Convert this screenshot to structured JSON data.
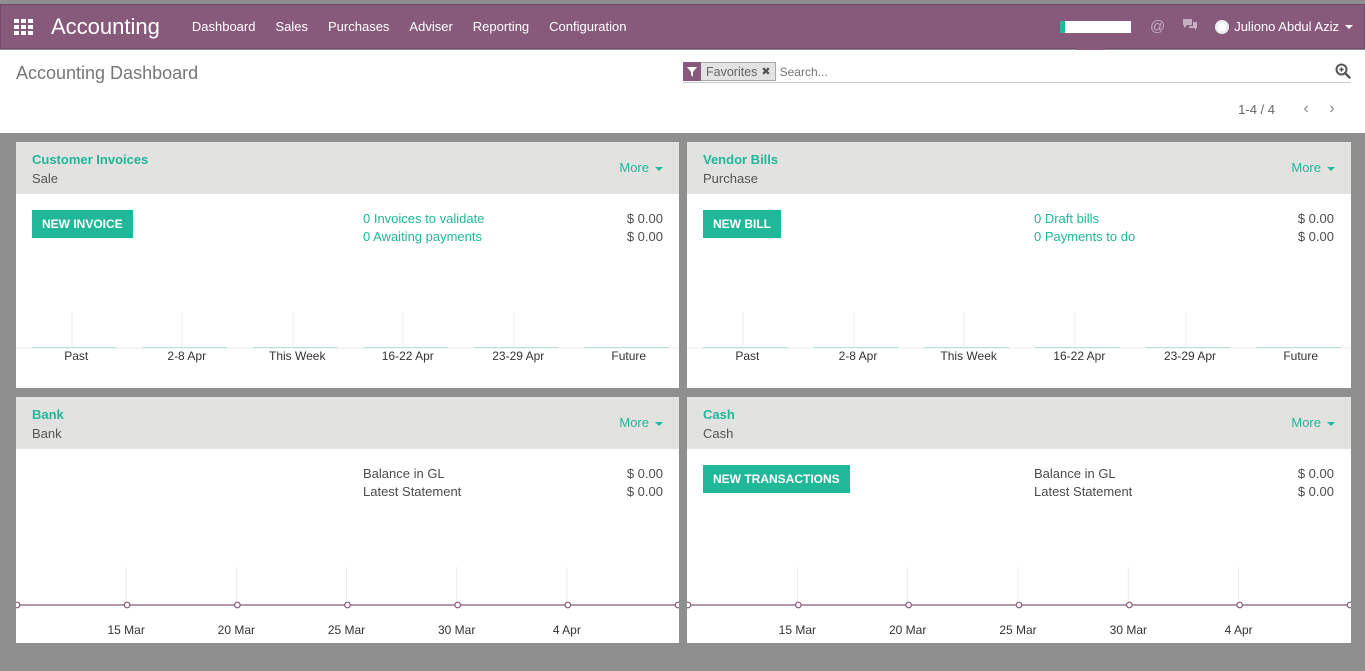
{
  "app": {
    "title": "Accounting",
    "menu": [
      "Dashboard",
      "Sales",
      "Purchases",
      "Adviser",
      "Reporting",
      "Configuration"
    ],
    "user": "Juliono Abdul Aziz"
  },
  "control": {
    "title": "Accounting Dashboard",
    "facet": "Favorites",
    "search_placeholder": "Search...",
    "pager": "1-4 / 4"
  },
  "colors": {
    "brand": "#875a7b",
    "accent": "#21b799",
    "line": "#875a7b"
  },
  "cards": [
    {
      "title": "Customer Invoices",
      "subtitle": "Sale",
      "more": "More",
      "button": "NEW INVOICE",
      "stats": [
        {
          "label": "0 Invoices to validate",
          "value": "$ 0.00"
        },
        {
          "label": "0 Awaiting payments",
          "value": "$ 0.00"
        }
      ],
      "chart_data": {
        "type": "bar",
        "categories": [
          "Past",
          "2-8 Apr",
          "This Week",
          "16-22 Apr",
          "23-29 Apr",
          "Future"
        ],
        "values": [
          0,
          0,
          0,
          0,
          0,
          0
        ]
      }
    },
    {
      "title": "Vendor Bills",
      "subtitle": "Purchase",
      "more": "More",
      "button": "NEW BILL",
      "stats": [
        {
          "label": "0 Draft bills",
          "value": "$ 0.00"
        },
        {
          "label": "0 Payments to do",
          "value": "$ 0.00"
        }
      ],
      "chart_data": {
        "type": "bar",
        "categories": [
          "Past",
          "2-8 Apr",
          "This Week",
          "16-22 Apr",
          "23-29 Apr",
          "Future"
        ],
        "values": [
          0,
          0,
          0,
          0,
          0,
          0
        ]
      }
    },
    {
      "title": "Bank",
      "subtitle": "Bank",
      "more": "More",
      "stats": [
        {
          "label": "Balance in GL",
          "value": "$ 0.00"
        },
        {
          "label": "Latest Statement",
          "value": "$ 0.00"
        }
      ],
      "chart_data": {
        "type": "line",
        "x": [
          "15 Mar",
          "20 Mar",
          "25 Mar",
          "30 Mar",
          "4 Apr"
        ],
        "values": [
          0,
          0,
          0,
          0,
          0,
          0,
          0
        ]
      }
    },
    {
      "title": "Cash",
      "subtitle": "Cash",
      "more": "More",
      "button": "NEW TRANSACTIONS",
      "stats": [
        {
          "label": "Balance in GL",
          "value": "$ 0.00"
        },
        {
          "label": "Latest Statement",
          "value": "$ 0.00"
        }
      ],
      "chart_data": {
        "type": "line",
        "x": [
          "15 Mar",
          "20 Mar",
          "25 Mar",
          "30 Mar",
          "4 Apr"
        ],
        "values": [
          0,
          0,
          0,
          0,
          0,
          0,
          0
        ]
      }
    }
  ]
}
